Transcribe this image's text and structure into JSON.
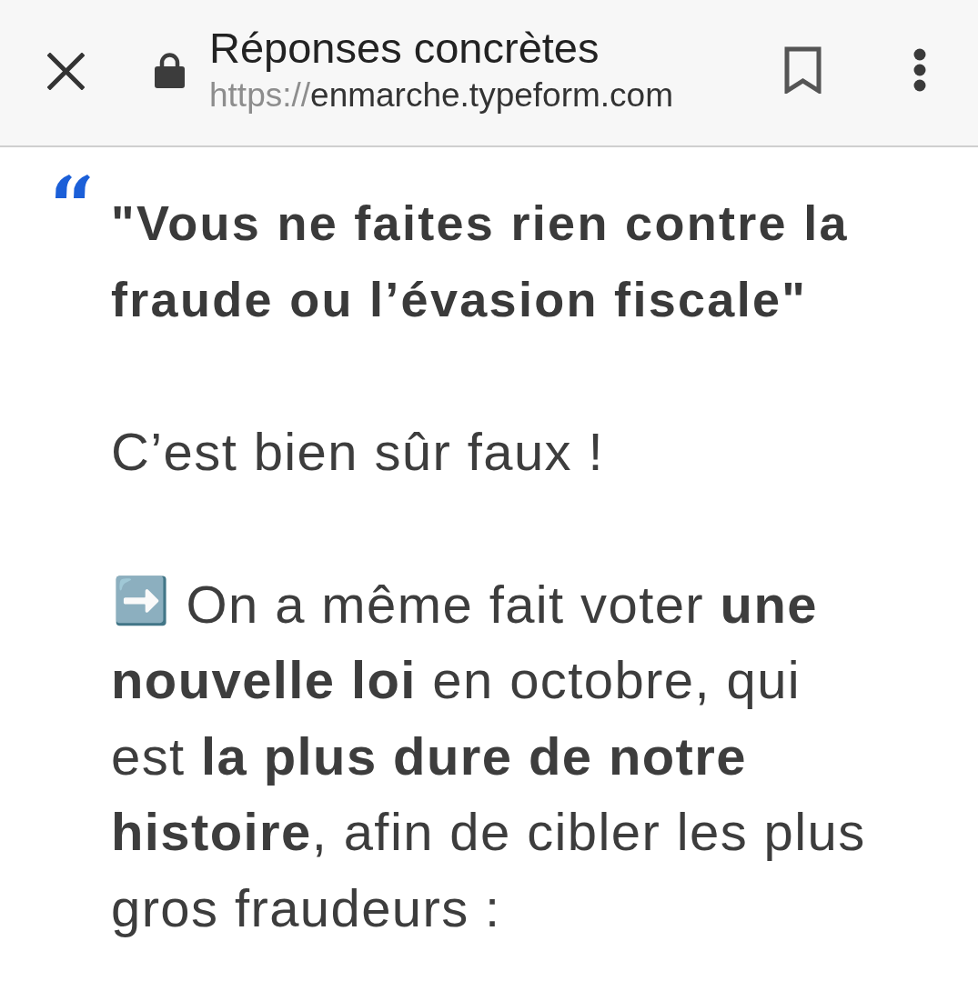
{
  "browser_bar": {
    "page_title": "Réponses concrètes",
    "url_scheme": "https://",
    "url_host": "enmarche.typeform.com"
  },
  "question": {
    "text": "\"Vous ne faites rien contre la fraude ou l’évasion fiscale\""
  },
  "answer": [
    {
      "kind": "plain",
      "text": "C’est bien sûr faux !"
    },
    {
      "kind": "arrow_item",
      "marker": "➡️",
      "text": "On a même fait voter **une nouvelle loi** en octobre, qui est **la plus dure de notre histoire**, afin de cibler les plus gros fraudeurs :"
    }
  ]
}
